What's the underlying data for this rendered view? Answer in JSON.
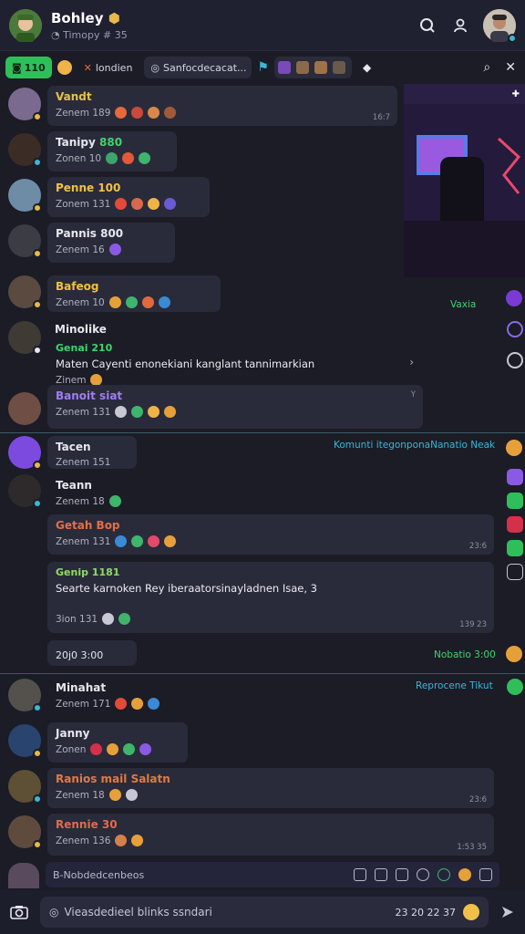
{
  "header": {
    "title": "Bohley",
    "subtitle": "Timopy # 35"
  },
  "tabs": {
    "count_label": "110",
    "active_label": "londien",
    "search_placeholder": "Sanfocdecacat..."
  },
  "messages": [
    {
      "name": "Vandt",
      "meta": "Zenem 189",
      "ts": "16:7",
      "name_color": "#e6c24a",
      "avatar_color": "#7b6a8f"
    },
    {
      "name": "Tanipy",
      "tag": "880",
      "meta": "Zonen 10",
      "name_color": "#ffffff",
      "avatar_color": "#3b2c26"
    },
    {
      "name": "Penne 100",
      "meta": "Zonem 131",
      "name_color": "#f0c04a",
      "avatar_color": "#6e8ca6"
    },
    {
      "name": "Pannis 800",
      "meta": "Zenem 16",
      "name_color": "#ffffff",
      "avatar_color": "#3c3c44"
    },
    {
      "name": "Bafeog",
      "meta": "Zenem 10",
      "name_color": "#f3c13b",
      "avatar_color": "#5b4a40"
    },
    {
      "name": "Minolike",
      "sub": "Genai 210",
      "body": "Maten Cayenti enonekiani kanglant tannimarkian",
      "meta": "Zinem",
      "name_color": "#ffffff",
      "avatar_color": "#3f3a33"
    },
    {
      "name": "Banoit siat",
      "meta": "Zenem 131",
      "ts": "Y",
      "name_color": "#a07cf2",
      "avatar_color": "#6f4e46"
    },
    {
      "name": "Tacen",
      "meta": "Zenem 151",
      "name_color": "#ffffff",
      "avatar_color": "#7c4adf"
    },
    {
      "name": "Teann",
      "meta": "Zenem 18",
      "name_color": "#ffffff",
      "avatar_color": "#2e2a2c"
    },
    {
      "name": "Getah Bop",
      "meta": "Zenem 131",
      "ts": "23:6",
      "name_color": "#e46e45"
    },
    {
      "name": "Genip 1181",
      "body": "Searte karnoken Rey iberaatorsinayladnen Isae, 3",
      "meta": "3ion 131",
      "ts": "139 23",
      "name_color": "#8fdb6a"
    },
    {
      "name": "Minahat",
      "meta": "Zenem 171",
      "name_color": "#ffffff",
      "avatar_color": "#54504c"
    },
    {
      "name": "Janny",
      "meta": "Zonen",
      "name_color": "#ffffff",
      "avatar_color": "#29446e"
    },
    {
      "name": "Ranios mail Salatn",
      "meta": "Zenem 18",
      "ts": "23:6",
      "name_color": "#e07a44",
      "avatar_color": "#5e5035"
    },
    {
      "name": "Rennie 30",
      "meta": "Zenem 136",
      "ts": "1:53 35",
      "name_color": "#e06a4e",
      "avatar_color": "#5f4a3e"
    }
  ],
  "notes": {
    "waxia": "Vaxia",
    "komunti": "Komunti itegonponaNanatio Neak",
    "date_chip": "20j0 3:00",
    "nobatio": "Nobatio 3:00",
    "reprocene": "Reprocene Tikut"
  },
  "composer": {
    "tools_label": "B-Nobdedcenbeos",
    "placeholder": "Vieasdedieel blinks ssndari",
    "stats": "23 20 22 37"
  },
  "colors": {
    "accent_green": "#2fbf5a",
    "accent_teal": "#39b8d6",
    "accent_purple": "#a07cf2",
    "background": "#1b1c26"
  }
}
